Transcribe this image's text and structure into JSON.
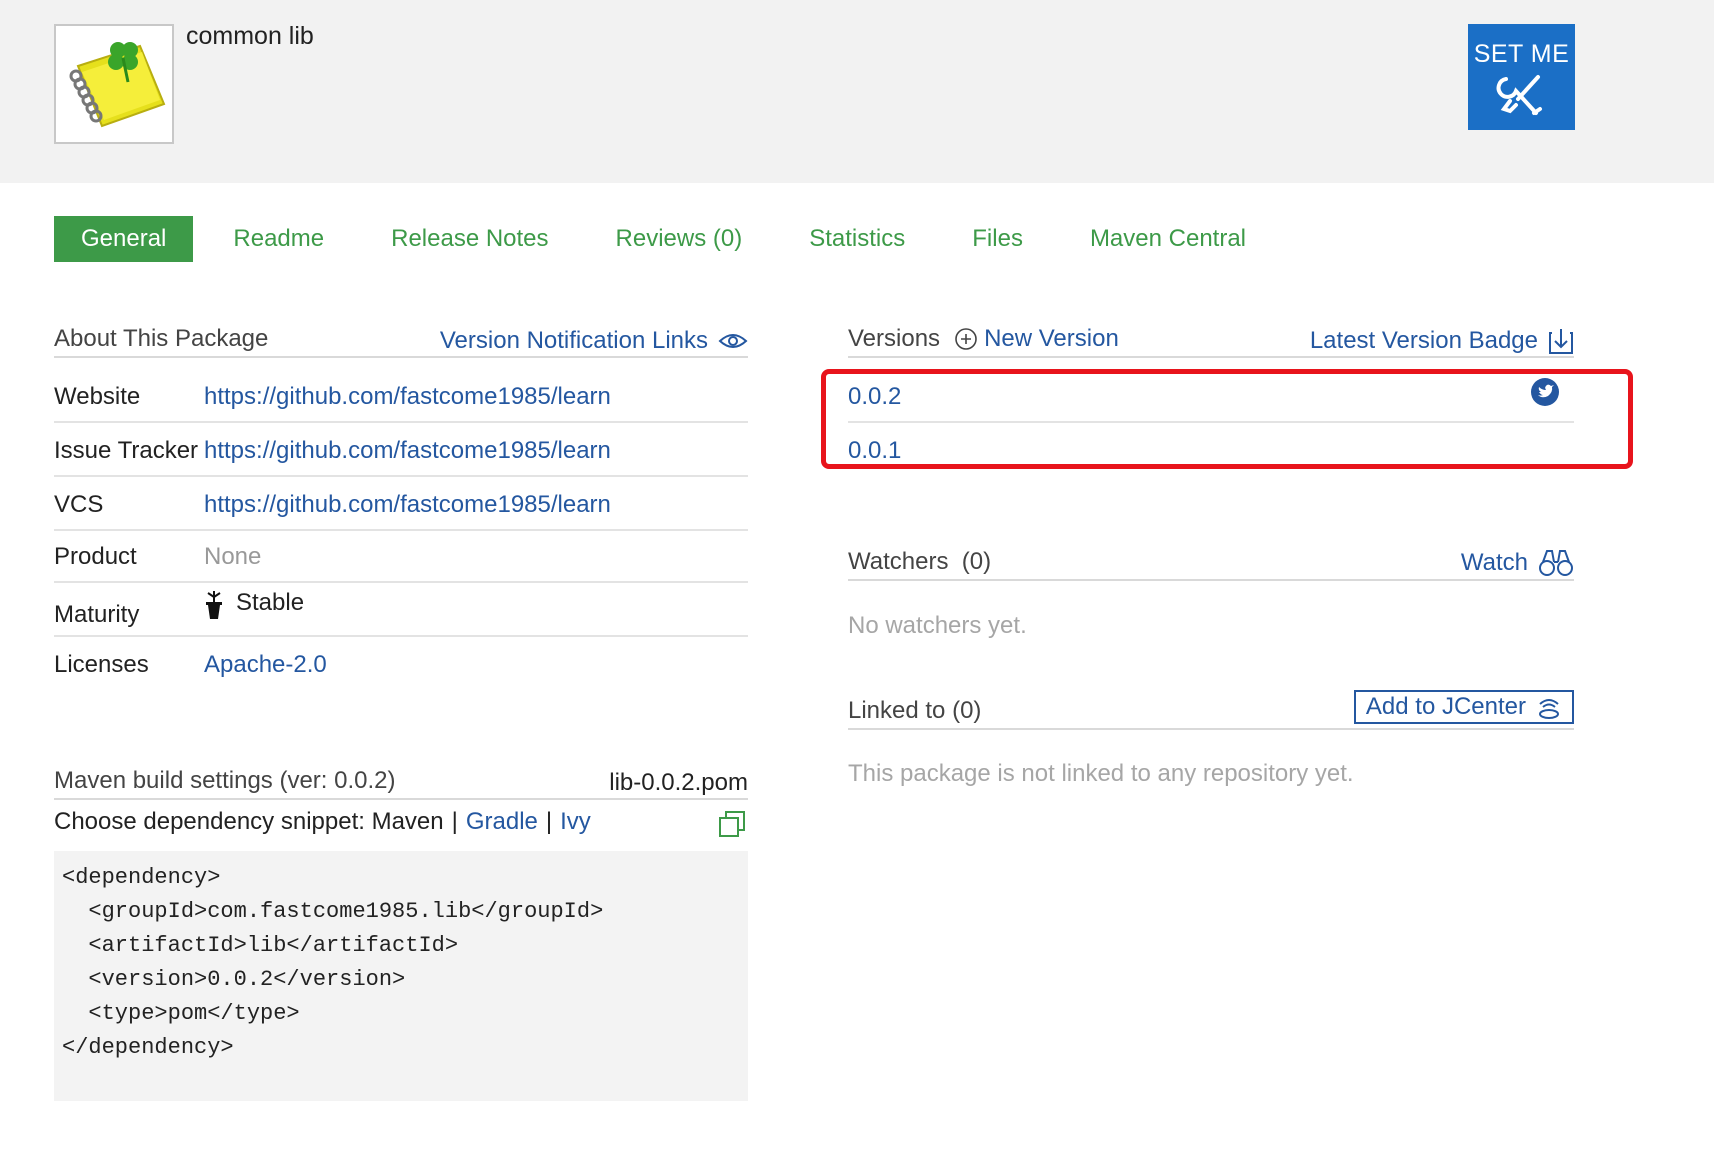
{
  "header": {
    "package_name": "common lib",
    "setme_label": "SET ME",
    "setme_icon": "tools-icon"
  },
  "tabs": [
    {
      "label": "General",
      "active": true
    },
    {
      "label": "Readme"
    },
    {
      "label": "Release Notes"
    },
    {
      "label": "Reviews (0)"
    },
    {
      "label": "Statistics"
    },
    {
      "label": "Files"
    },
    {
      "label": "Maven Central"
    }
  ],
  "about": {
    "title": "About This Package",
    "notification_link": "Version Notification Links",
    "rows": [
      {
        "label": "Website",
        "value": "https://github.com/fastcome1985/learn"
      },
      {
        "label": "Issue Tracker",
        "value": "https://github.com/fastcome1985/learn"
      },
      {
        "label": "VCS",
        "value": "https://github.com/fastcome1985/learn"
      },
      {
        "label": "Product",
        "value": "None"
      },
      {
        "label": "Maturity",
        "value": "Stable"
      },
      {
        "label": "Licenses",
        "value": "Apache-2.0"
      }
    ]
  },
  "maven": {
    "title": "Maven build settings (ver: 0.0.2)",
    "pom_link": "lib-0.0.2.pom",
    "choose_label": "Choose dependency snippet:",
    "options": [
      "Maven",
      "Gradle",
      "Ivy"
    ],
    "separator": "|",
    "snippet": "<dependency>\n  <groupId>com.fastcome1985.lib</groupId>\n  <artifactId>lib</artifactId>\n  <version>0.0.2</version>\n  <type>pom</type>\n</dependency>"
  },
  "versions": {
    "title": "Versions",
    "new_version": "New Version",
    "badge_link": "Latest Version Badge",
    "items": [
      "0.0.2",
      "0.0.1"
    ]
  },
  "watchers": {
    "title": "Watchers  (0)",
    "watch_link": "Watch",
    "empty": "No watchers yet."
  },
  "linked": {
    "title": "Linked to (0)",
    "add_button": "Add to JCenter",
    "empty": "This package is not linked to any repository yet."
  },
  "colors": {
    "accent_green": "#3d9a48",
    "link_blue": "#2457a0",
    "setme_blue": "#1b6fc6",
    "highlight_red": "#e8141c"
  }
}
